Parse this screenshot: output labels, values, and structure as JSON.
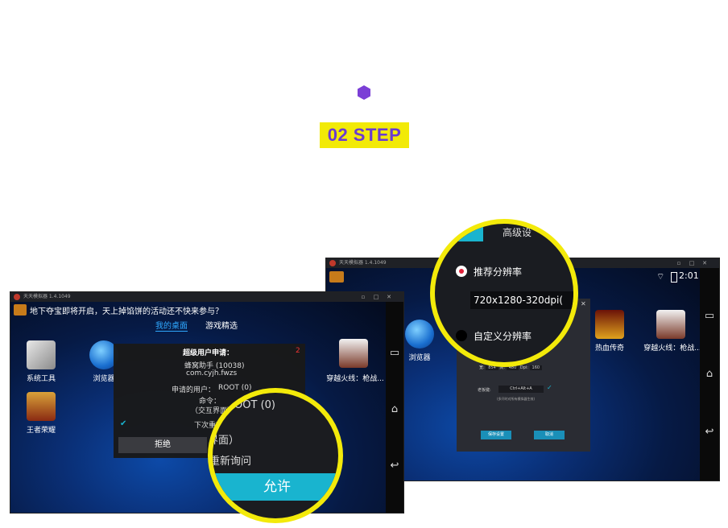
{
  "header": {
    "step_label": "02 STEP"
  },
  "left_window": {
    "title": "天天模拟器 1.4.1049",
    "banner": "地下夺宝即将开启，天上掉馅饼的活动还不快来参与？",
    "tabs": [
      "我的桌面",
      "游戏精选"
    ],
    "apps": [
      {
        "label": "系统工具"
      },
      {
        "label": "浏览器"
      },
      {
        "label": "穿越火线：枪战..."
      },
      {
        "label": "王者荣耀"
      }
    ],
    "dialog": {
      "title": "超级用户申请：",
      "count": "2",
      "app_name": "蜂窝助手 (10038)",
      "package": "com.cyjh.fwzs",
      "user_label": "申请的用户：",
      "user_value": "ROOT (0)",
      "command_label": "命令：",
      "command_value": "（交互界面）ROOT (0)",
      "remember": "下次重新询问",
      "deny": "拒绝"
    },
    "zoom": {
      "user_line": "ROOT (0)",
      "interface_line": "界面）",
      "ask_again": "重新询问",
      "allow": "允许"
    }
  },
  "right_window": {
    "title": "天天模拟器 1.4.1049",
    "clock": "2:01",
    "apps": [
      {
        "label": "浏览器"
      },
      {
        "label": "热血传奇"
      },
      {
        "label": "穿越火线：枪战..."
      }
    ],
    "settings": {
      "width_label": "宽:",
      "width_value": "854",
      "height_label": "高:",
      "height_value": "480",
      "dpi_label": "Dpi:",
      "dpi_value": "160",
      "shortcut_label": "老板键:",
      "shortcut_value": "Ctrl+Alt+A",
      "note": "(多开时对所有模拟器生效)",
      "save": "保存设置",
      "cancel": "取消"
    },
    "zoom": {
      "tab": "高级设",
      "option1": "推荐分辨率",
      "resolution": "720x1280-320dpi(",
      "option2": "自定义分辨率"
    }
  },
  "colors": {
    "accent_yellow": "#f3ea0a",
    "accent_purple": "#7b3fd6",
    "allow_cyan": "#19b4cf"
  }
}
